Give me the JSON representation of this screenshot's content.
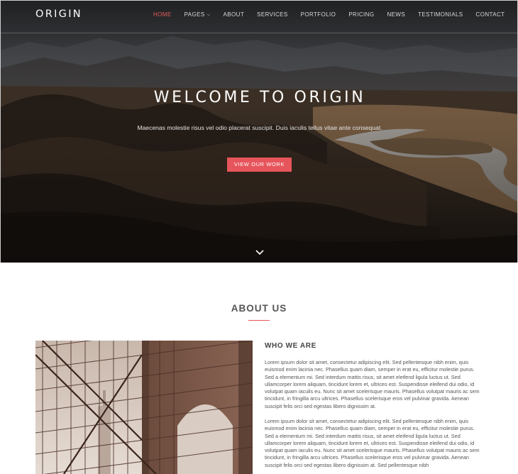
{
  "brand": {
    "logo": "ORIGIN"
  },
  "nav": {
    "items": [
      {
        "label": "HOME",
        "active": true
      },
      {
        "label": "PAGES",
        "dropdown": true
      },
      {
        "label": "ABOUT"
      },
      {
        "label": "SERVICES"
      },
      {
        "label": "PORTFOLIO"
      },
      {
        "label": "PRICING"
      },
      {
        "label": "NEWS"
      },
      {
        "label": "TESTIMONIALS"
      },
      {
        "label": "CONTACT"
      }
    ],
    "dropdown_icon": "chevron-down-icon"
  },
  "hero": {
    "title": "WELCOME TO ORIGIN",
    "subtitle": "Maecenas molestie risus vel odio placerat suscipit. Duis iaculis tellus vitae ante consequat.",
    "button_label": "VIEW OUR WORK",
    "scroll_icon": "chevron-down-icon"
  },
  "about": {
    "heading": "ABOUT US",
    "subheading": "WHO WE ARE",
    "paragraphs": [
      "Lorem ipsum dolor sit amet, consectetur adipiscing elit. Sed pellentesque nibh enim, quis euismod enim lacinia nec. Phasellus quam diam, semper in erat eu, efficitur molestie purus. Sed a elementum mi. Sed interdum mattis risus, sit amet eleifend ligula luctus ut. Sed ullamcorper lorem aliquam, tincidunt lorem et, ultrices est. Suspendisse eleifend dui odio, id volutpat quam iaculis eu. Nunc sit amet scelerisque mauris. Phasellus volutpat mauris ac sem tincidunt, in fringilla arcu ultrices. Phasellus scelerisque eros vel pulvinar gravida. Aenean suscipit felis orci sed egestas libero dignissim at.",
      "Lorem ipsum dolor sit amet, consectetur adipiscing elit. Sed pellentesque nibh enim, quis euismod enim lacinia nec. Phasellus quam diam, semper in erat eu, efficitur molestie purus. Sed a elementum mi. Sed interdum mattis risus, sit amet eleifend ligula luctus ut. Sed ullamcorper lorem aliquam, tincidunt lorem et, ultrices est. Suspendisse eleifend dui odio, id volutpat quam iaculis eu. Nunc sit amet scelerisque mauris. Phasellus volutpat mauris ac sem tincidunt, in fringilla arcu ultrices. Phasellus scelerisque eros vel pulvinar gravida. Aenean suscipit felis orci sed egestas libero dignissim at. Sed pellentesque nibh"
    ]
  },
  "colors": {
    "accent": "#e6555b",
    "nav_text": "#d8d8d8",
    "hero_text": "#ffffff",
    "body_text": "#555555"
  }
}
